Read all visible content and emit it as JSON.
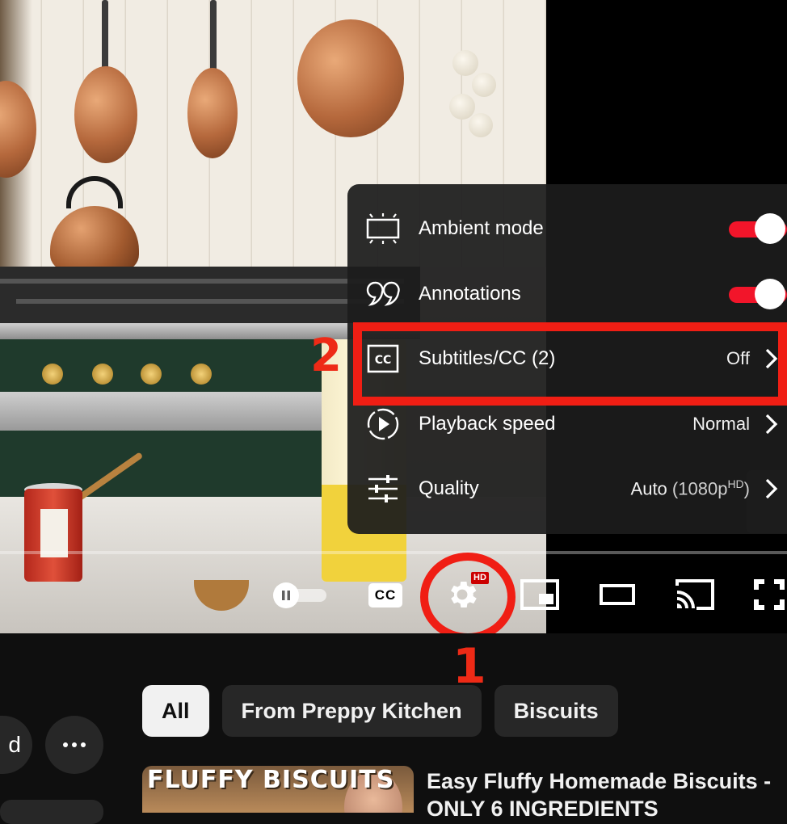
{
  "player": {
    "settings_menu": {
      "items": [
        {
          "label": "Ambient mode",
          "type": "toggle",
          "on": true,
          "icon": "ambient-mode-icon"
        },
        {
          "label": "Annotations",
          "type": "toggle",
          "on": true,
          "icon": "annotations-icon"
        },
        {
          "label": "Subtitles/CC (2)",
          "type": "submenu",
          "value": "Off",
          "icon": "cc-icon"
        },
        {
          "label": "Playback speed",
          "type": "submenu",
          "value": "Normal",
          "icon": "playback-speed-icon"
        },
        {
          "label": "Quality",
          "type": "submenu",
          "value": "Auto",
          "value_detail": "(1080p",
          "value_sup": "HD",
          "value_close": ")",
          "icon": "quality-sliders-icon"
        }
      ]
    },
    "controls": {
      "cc_label": "CC",
      "hd_badge": "HD"
    },
    "annotations": {
      "marker_1": "1",
      "marker_2": "2"
    },
    "colors": {
      "annotation_red": "#f01e14",
      "toggle_on": "#f2152a",
      "menu_bg": "#1c1c1c"
    }
  },
  "chips": [
    "All",
    "From Preppy Kitchen",
    "Biscuits"
  ],
  "left_partial_button": "d",
  "recommended": {
    "thumb_text": "FLUFFY BISCUITS",
    "title": "Easy Fluffy Homemade Biscuits - ONLY 6 INGREDIENTS"
  }
}
